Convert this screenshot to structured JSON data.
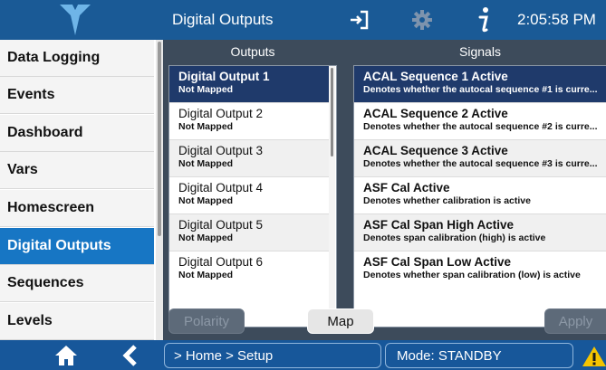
{
  "header": {
    "title": "Digital Outputs",
    "clock": "2:05:58 PM",
    "logo_icon": "teledyne-logo-icon",
    "icons": [
      "exit-icon",
      "gear-icon",
      "info-icon"
    ]
  },
  "sidebar": {
    "items": [
      {
        "label": "Data Logging"
      },
      {
        "label": "Events"
      },
      {
        "label": "Dashboard"
      },
      {
        "label": "Vars"
      },
      {
        "label": "Homescreen"
      },
      {
        "label": "Digital Outputs",
        "active": true
      },
      {
        "label": "Sequences"
      },
      {
        "label": "Levels"
      }
    ]
  },
  "outputs": {
    "header": "Outputs",
    "items": [
      {
        "name": "Digital Output 1",
        "status": "Not Mapped",
        "selected": true
      },
      {
        "name": "Digital Output 2",
        "status": "Not Mapped"
      },
      {
        "name": "Digital Output 3",
        "status": "Not Mapped"
      },
      {
        "name": "Digital Output 4",
        "status": "Not Mapped"
      },
      {
        "name": "Digital Output 5",
        "status": "Not Mapped"
      },
      {
        "name": "Digital Output 6",
        "status": "Not Mapped"
      }
    ]
  },
  "signals": {
    "header": "Signals",
    "items": [
      {
        "name": "ACAL Sequence 1 Active",
        "desc": "Denotes whether the autocal sequence #1 is curre...",
        "selected": true
      },
      {
        "name": "ACAL Sequence 2 Active",
        "desc": "Denotes whether the autocal sequence #2 is curre..."
      },
      {
        "name": "ACAL Sequence 3 Active",
        "desc": "Denotes whether the autocal sequence #3 is curre..."
      },
      {
        "name": "ASF Cal Active",
        "desc": "Denotes whether calibration is active"
      },
      {
        "name": "ASF Cal Span High Active",
        "desc": "Denotes span calibration (high) is active"
      },
      {
        "name": "ASF Cal Span Low Active",
        "desc": "Denotes whether span calibration (low) is active"
      }
    ]
  },
  "buttons": {
    "polarity": "Polarity",
    "map": "Map",
    "apply": "Apply"
  },
  "footer": {
    "breadcrumb": "> Home > Setup",
    "mode": "Mode: STANDBY",
    "icons": [
      "home-icon",
      "back-icon",
      "warning-icon"
    ]
  },
  "colors": {
    "header_blue": "#1a5a96",
    "active_blue": "#1776c4",
    "selected_navy": "#1f3a6b",
    "panel_gray": "#3d4b5b",
    "warning_yellow": "#f5c400"
  }
}
